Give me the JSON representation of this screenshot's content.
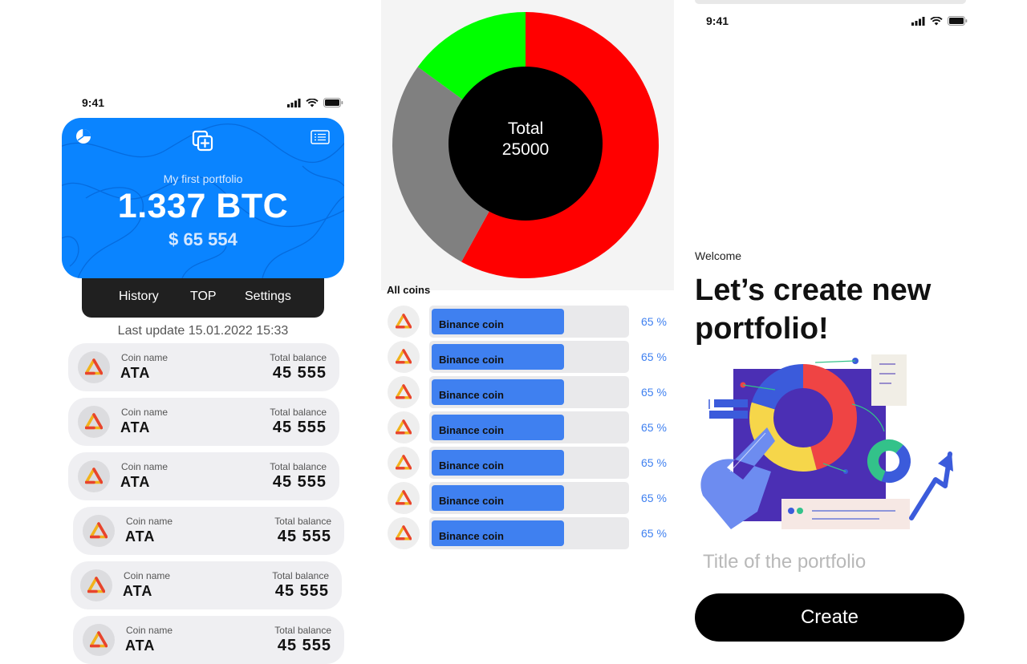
{
  "statusbar": {
    "time": "9:41"
  },
  "portfolio_card": {
    "name": "My first portfolio",
    "amount": "1.337 BTC",
    "fiat": "$ 65 554",
    "color": "#0A84FF"
  },
  "tabs": [
    "History",
    "TOP",
    "Settings"
  ],
  "last_update": "Last update 15.01.2022 15:33",
  "coin_list": {
    "name_label": "Coin name",
    "balance_label": "Total balance",
    "items": [
      {
        "name": "ATA",
        "balance": "45 555"
      },
      {
        "name": "ATA",
        "balance": "45 555"
      },
      {
        "name": "ATA",
        "balance": "45 555"
      },
      {
        "name": "ATA",
        "balance": "45 555"
      },
      {
        "name": "ATA",
        "balance": "45 555"
      },
      {
        "name": "ATA",
        "balance": "45 555"
      }
    ]
  },
  "allocation": {
    "center_label": "Total",
    "center_value": "25000",
    "segment_colors": [
      "#ff0000",
      "#808080",
      "#00ff00"
    ],
    "segment_shares": [
      0.58,
      0.27,
      0.15
    ]
  },
  "all_coins": {
    "title": "All coins",
    "bar_color": "#3F80F0",
    "items": [
      {
        "name": "Binance coin",
        "percent": "65 %",
        "fill": 0.68
      },
      {
        "name": "Binance coin",
        "percent": "65 %",
        "fill": 0.68
      },
      {
        "name": "Binance coin",
        "percent": "65 %",
        "fill": 0.68
      },
      {
        "name": "Binance coin",
        "percent": "65 %",
        "fill": 0.68
      },
      {
        "name": "Binance coin",
        "percent": "65 %",
        "fill": 0.68
      },
      {
        "name": "Binance coin",
        "percent": "65 %",
        "fill": 0.68
      },
      {
        "name": "Binance coin",
        "percent": "65 %",
        "fill": 0.68
      }
    ]
  },
  "create_screen": {
    "welcome": "Welcome",
    "headline": "Let’s create new portfolio!",
    "input_placeholder": "Title of the portfolio",
    "create_label": "Create"
  },
  "icons": [
    "pie-chart-icon",
    "add-copy-icon",
    "list-icon",
    "coin-logo-icon",
    "signal-icon",
    "wifi-icon",
    "battery-icon"
  ]
}
